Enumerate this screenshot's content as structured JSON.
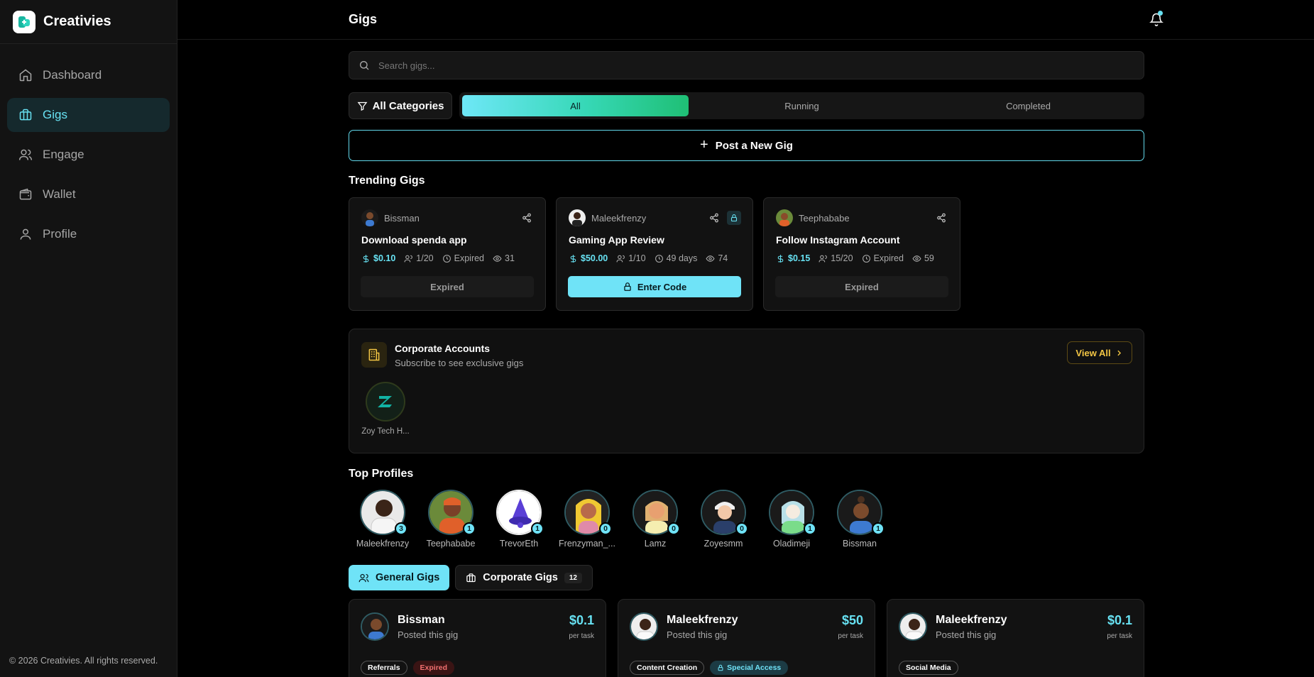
{
  "brand": {
    "name": "Creativies"
  },
  "nav": [
    {
      "label": "Dashboard",
      "icon": "home-icon"
    },
    {
      "label": "Gigs",
      "icon": "briefcase-icon"
    },
    {
      "label": "Engage",
      "icon": "users-icon"
    },
    {
      "label": "Wallet",
      "icon": "wallet-icon"
    },
    {
      "label": "Profile",
      "icon": "user-icon"
    }
  ],
  "footer": "© 2026 Creativies. All rights reserved.",
  "header": {
    "title": "Gigs"
  },
  "search": {
    "placeholder": "Search gigs..."
  },
  "filters": {
    "category_label": "All Categories",
    "tabs": [
      "All",
      "Running",
      "Completed"
    ],
    "active_tab": "All"
  },
  "post_gig": {
    "label": "Post a New Gig"
  },
  "trending": {
    "title": "Trending Gigs",
    "cards": [
      {
        "user": "Bissman",
        "title": "Download spenda app",
        "price": "$0.10",
        "slots": "1/20",
        "time": "Expired",
        "views": "31",
        "action": "Expired"
      },
      {
        "user": "Maleekfrenzy",
        "title": "Gaming App Review",
        "price": "$50.00",
        "slots": "1/10",
        "time": "49 days",
        "views": "74",
        "action": "Enter Code"
      },
      {
        "user": "Teephababe",
        "title": "Follow Instagram Account",
        "price": "$0.15",
        "slots": "15/20",
        "time": "Expired",
        "views": "59",
        "action": "Expired"
      }
    ]
  },
  "corporate": {
    "title": "Corporate Accounts",
    "subtitle": "Subscribe to see exclusive gigs",
    "view_all": "View All",
    "accounts": [
      {
        "name": "Zoy Tech H..."
      }
    ]
  },
  "top_profiles": {
    "title": "Top Profiles",
    "items": [
      {
        "name": "Maleekfrenzy",
        "count": "3"
      },
      {
        "name": "Teephababe",
        "count": "1"
      },
      {
        "name": "TrevorEth",
        "count": "1"
      },
      {
        "name": "Frenzyman_...",
        "count": "0"
      },
      {
        "name": "Lamz",
        "count": "0"
      },
      {
        "name": "Zoyesmm",
        "count": "0"
      },
      {
        "name": "Oladimeji",
        "count": "1"
      },
      {
        "name": "Bissman",
        "count": "1"
      }
    ]
  },
  "gig_tabs": {
    "general": "General Gigs",
    "corporate": "Corporate Gigs",
    "corporate_count": "12"
  },
  "gigs": [
    {
      "user": "Bissman",
      "sub": "Posted this gig",
      "price": "$0.1",
      "per": "per task",
      "tags": [
        "Referrals",
        "Expired"
      ]
    },
    {
      "user": "Maleekfrenzy",
      "sub": "Posted this gig",
      "price": "$50",
      "per": "per task",
      "tags": [
        "Content Creation",
        "Special Access"
      ]
    },
    {
      "user": "Maleekfrenzy",
      "sub": "Posted this gig",
      "price": "$0.1",
      "per": "per task",
      "tags": [
        "Social Media"
      ]
    }
  ],
  "colors": {
    "accent": "#67e1f2",
    "gold": "#f2c544",
    "background": "#000000",
    "sidebar": "#131313"
  }
}
